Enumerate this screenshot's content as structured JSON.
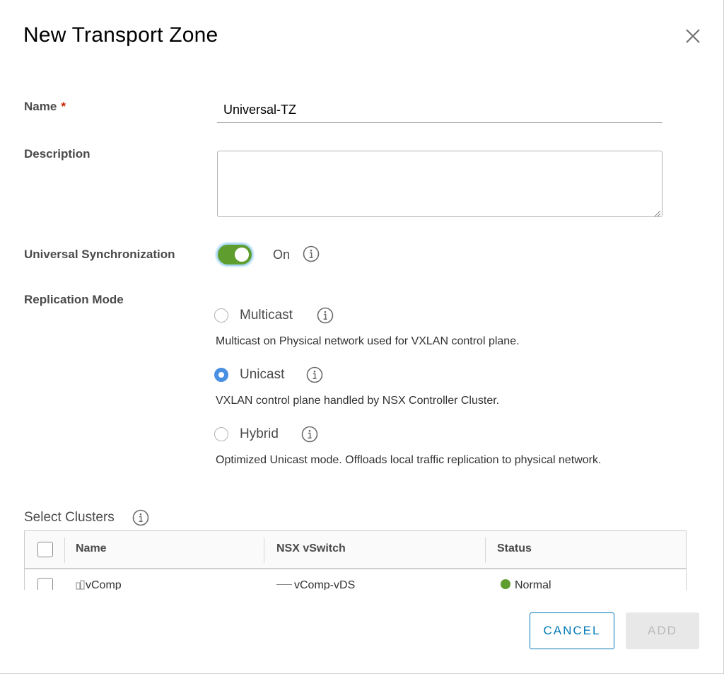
{
  "dialog": {
    "title": "New Transport Zone"
  },
  "form": {
    "name_label": "Name",
    "required_marker": "*",
    "name_value": "Universal-TZ",
    "description_label": "Description",
    "description_value": "",
    "sync_label": "Universal Synchronization",
    "sync_state": "On",
    "replication_label": "Replication Mode",
    "replication_options": [
      {
        "label": "Multicast",
        "help": "Multicast on Physical network used for VXLAN control plane.",
        "selected": false
      },
      {
        "label": "Unicast",
        "help": "VXLAN control plane handled by NSX Controller Cluster.",
        "selected": true
      },
      {
        "label": "Hybrid",
        "help": "Optimized Unicast mode. Offloads local traffic replication to physical network.",
        "selected": false
      }
    ]
  },
  "clusters": {
    "label": "Select Clusters",
    "columns": [
      "Name",
      "NSX vSwitch",
      "Status"
    ],
    "rows": [
      {
        "name": "vComp",
        "vswitch": "vComp-vDS",
        "status": "Normal"
      }
    ]
  },
  "footer": {
    "cancel_label": "CANCEL",
    "add_label": "ADD"
  },
  "colors": {
    "toggle_on": "#5f9d2f",
    "radio_selected": "#4a90e2",
    "required": "#c92100",
    "primary": "#0079b8",
    "status_normal": "#5f9d2f"
  },
  "icons": {
    "close": "close-icon",
    "info": "info-icon",
    "cluster": "cluster-icon",
    "vswitch": "vswitch-icon"
  }
}
